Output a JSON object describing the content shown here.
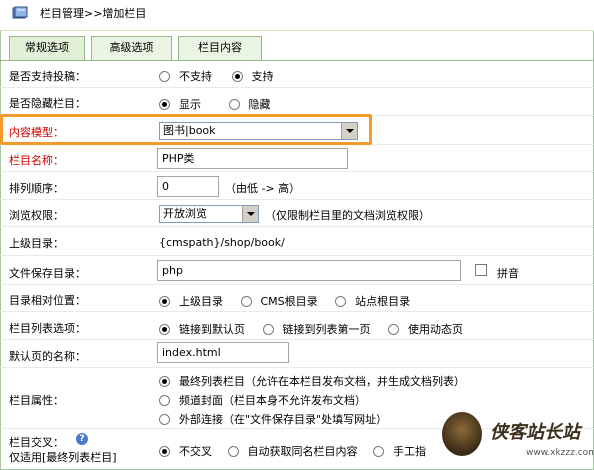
{
  "breadcrumb": "栏目管理>>增加栏目",
  "tabs": [
    {
      "label": "常规选项",
      "active": true
    },
    {
      "label": "高级选项",
      "active": false
    },
    {
      "label": "栏目内容",
      "active": false
    }
  ],
  "fields": {
    "allow_submit": {
      "label": "是否支持投稿：",
      "options": [
        "不支持",
        "支持"
      ],
      "selected": "支持"
    },
    "hidden": {
      "label": "是否隐藏栏目：",
      "options": [
        "显示",
        "隐藏"
      ],
      "selected": "显示"
    },
    "content_model": {
      "label": "内容模型：",
      "value": "图书|book"
    },
    "name": {
      "label": "栏目名称：",
      "value": "PHP类"
    },
    "sort_order": {
      "label": "排列顺序：",
      "value": "0",
      "hint": "（由低 -> 高）"
    },
    "browse_permission": {
      "label": "浏览权限：",
      "value": "开放浏览",
      "hint": "（仅限制栏目里的文档浏览权限）"
    },
    "parent_dir": {
      "label": "上级目录：",
      "value": "{cmspath}/shop/book/"
    },
    "save_dir": {
      "label": "文件保存目录：",
      "value": "php",
      "pinyin_label": "拼音"
    },
    "relative_position": {
      "label": "目录相对位置：",
      "options": [
        "上级目录",
        "CMS根目录",
        "站点根目录"
      ],
      "selected": "上级目录"
    },
    "list_option": {
      "label": "栏目列表选项：",
      "options": [
        "链接到默认页",
        "链接到列表第一页",
        "使用动态页"
      ],
      "selected": "链接到默认页"
    },
    "default_page": {
      "label": "默认页的名称：",
      "value": "index.html"
    },
    "attribute": {
      "label": "栏目属性：",
      "options": [
        "最终列表栏目（允许在本栏目发布文档，并生成文档列表）",
        "频道封面（栏目本身不允许发布文档）",
        "外部连接（在\"文件保存目录\"处填写网址）"
      ],
      "selected": "最终列表栏目（允许在本栏目发布文档，并生成文档列表）"
    },
    "cross": {
      "label": "栏目交叉：",
      "sublabel": "仅适用[最终列表栏目]",
      "options": [
        "不交叉",
        "自动获取同名栏目内容",
        "手工指"
      ],
      "selected": "不交叉"
    }
  },
  "watermark": {
    "title": "侠客站长站",
    "url": "www.xkzzz.com"
  },
  "colors": {
    "highlight": "#f39a2b",
    "required_label": "#d00000",
    "tab_bg": "#e1f0d6"
  }
}
